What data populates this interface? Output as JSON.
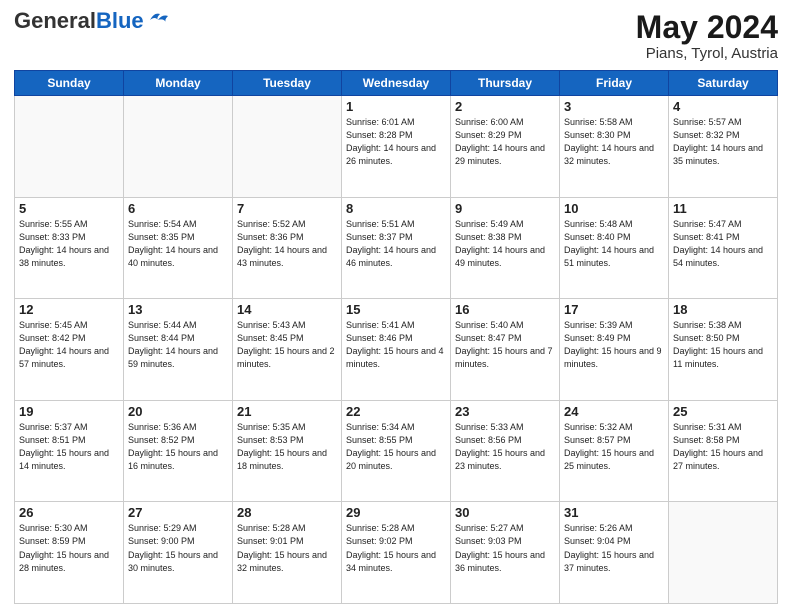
{
  "logo": {
    "general": "General",
    "blue": "Blue"
  },
  "header": {
    "month_year": "May 2024",
    "location": "Pians, Tyrol, Austria"
  },
  "weekdays": [
    "Sunday",
    "Monday",
    "Tuesday",
    "Wednesday",
    "Thursday",
    "Friday",
    "Saturday"
  ],
  "weeks": [
    [
      {
        "day": "",
        "info": ""
      },
      {
        "day": "",
        "info": ""
      },
      {
        "day": "",
        "info": ""
      },
      {
        "day": "1",
        "info": "Sunrise: 6:01 AM\nSunset: 8:28 PM\nDaylight: 14 hours and 26 minutes."
      },
      {
        "day": "2",
        "info": "Sunrise: 6:00 AM\nSunset: 8:29 PM\nDaylight: 14 hours and 29 minutes."
      },
      {
        "day": "3",
        "info": "Sunrise: 5:58 AM\nSunset: 8:30 PM\nDaylight: 14 hours and 32 minutes."
      },
      {
        "day": "4",
        "info": "Sunrise: 5:57 AM\nSunset: 8:32 PM\nDaylight: 14 hours and 35 minutes."
      }
    ],
    [
      {
        "day": "5",
        "info": "Sunrise: 5:55 AM\nSunset: 8:33 PM\nDaylight: 14 hours and 38 minutes."
      },
      {
        "day": "6",
        "info": "Sunrise: 5:54 AM\nSunset: 8:35 PM\nDaylight: 14 hours and 40 minutes."
      },
      {
        "day": "7",
        "info": "Sunrise: 5:52 AM\nSunset: 8:36 PM\nDaylight: 14 hours and 43 minutes."
      },
      {
        "day": "8",
        "info": "Sunrise: 5:51 AM\nSunset: 8:37 PM\nDaylight: 14 hours and 46 minutes."
      },
      {
        "day": "9",
        "info": "Sunrise: 5:49 AM\nSunset: 8:38 PM\nDaylight: 14 hours and 49 minutes."
      },
      {
        "day": "10",
        "info": "Sunrise: 5:48 AM\nSunset: 8:40 PM\nDaylight: 14 hours and 51 minutes."
      },
      {
        "day": "11",
        "info": "Sunrise: 5:47 AM\nSunset: 8:41 PM\nDaylight: 14 hours and 54 minutes."
      }
    ],
    [
      {
        "day": "12",
        "info": "Sunrise: 5:45 AM\nSunset: 8:42 PM\nDaylight: 14 hours and 57 minutes."
      },
      {
        "day": "13",
        "info": "Sunrise: 5:44 AM\nSunset: 8:44 PM\nDaylight: 14 hours and 59 minutes."
      },
      {
        "day": "14",
        "info": "Sunrise: 5:43 AM\nSunset: 8:45 PM\nDaylight: 15 hours and 2 minutes."
      },
      {
        "day": "15",
        "info": "Sunrise: 5:41 AM\nSunset: 8:46 PM\nDaylight: 15 hours and 4 minutes."
      },
      {
        "day": "16",
        "info": "Sunrise: 5:40 AM\nSunset: 8:47 PM\nDaylight: 15 hours and 7 minutes."
      },
      {
        "day": "17",
        "info": "Sunrise: 5:39 AM\nSunset: 8:49 PM\nDaylight: 15 hours and 9 minutes."
      },
      {
        "day": "18",
        "info": "Sunrise: 5:38 AM\nSunset: 8:50 PM\nDaylight: 15 hours and 11 minutes."
      }
    ],
    [
      {
        "day": "19",
        "info": "Sunrise: 5:37 AM\nSunset: 8:51 PM\nDaylight: 15 hours and 14 minutes."
      },
      {
        "day": "20",
        "info": "Sunrise: 5:36 AM\nSunset: 8:52 PM\nDaylight: 15 hours and 16 minutes."
      },
      {
        "day": "21",
        "info": "Sunrise: 5:35 AM\nSunset: 8:53 PM\nDaylight: 15 hours and 18 minutes."
      },
      {
        "day": "22",
        "info": "Sunrise: 5:34 AM\nSunset: 8:55 PM\nDaylight: 15 hours and 20 minutes."
      },
      {
        "day": "23",
        "info": "Sunrise: 5:33 AM\nSunset: 8:56 PM\nDaylight: 15 hours and 23 minutes."
      },
      {
        "day": "24",
        "info": "Sunrise: 5:32 AM\nSunset: 8:57 PM\nDaylight: 15 hours and 25 minutes."
      },
      {
        "day": "25",
        "info": "Sunrise: 5:31 AM\nSunset: 8:58 PM\nDaylight: 15 hours and 27 minutes."
      }
    ],
    [
      {
        "day": "26",
        "info": "Sunrise: 5:30 AM\nSunset: 8:59 PM\nDaylight: 15 hours and 28 minutes."
      },
      {
        "day": "27",
        "info": "Sunrise: 5:29 AM\nSunset: 9:00 PM\nDaylight: 15 hours and 30 minutes."
      },
      {
        "day": "28",
        "info": "Sunrise: 5:28 AM\nSunset: 9:01 PM\nDaylight: 15 hours and 32 minutes."
      },
      {
        "day": "29",
        "info": "Sunrise: 5:28 AM\nSunset: 9:02 PM\nDaylight: 15 hours and 34 minutes."
      },
      {
        "day": "30",
        "info": "Sunrise: 5:27 AM\nSunset: 9:03 PM\nDaylight: 15 hours and 36 minutes."
      },
      {
        "day": "31",
        "info": "Sunrise: 5:26 AM\nSunset: 9:04 PM\nDaylight: 15 hours and 37 minutes."
      },
      {
        "day": "",
        "info": ""
      }
    ]
  ]
}
